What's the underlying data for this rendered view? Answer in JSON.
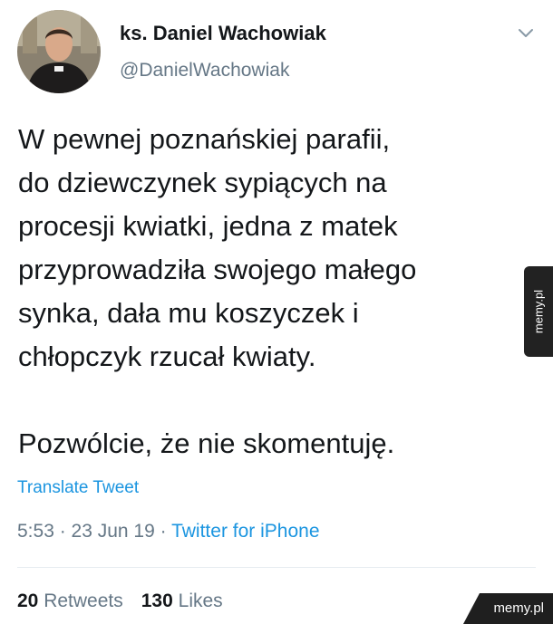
{
  "author": {
    "name": "ks. Daniel Wachowiak",
    "handle": "@DanielWachowiak"
  },
  "tweet": {
    "paragraphs": [
      "W pewnej poznańskiej parafii,\ndo dziewczynek sypiących na\nprocesji kwiatki, jedna z matek\nprzyprowadziła swojego małego\nsynka, dała mu koszyczek i\nchłopczyk rzucał kwiaty.",
      "Pozwólcie, że nie skomentuję."
    ],
    "translate_label": "Translate Tweet",
    "time": "5:53",
    "date": "23 Jun 19",
    "source": "Twitter for iPhone"
  },
  "stats": {
    "retweets_count": "20",
    "retweets_label": "Retweets",
    "likes_count": "130",
    "likes_label": "Likes"
  },
  "watermark": {
    "side": "memy.pl",
    "corner": "memy.pl"
  },
  "icons": {
    "chevron": "chevron-down-icon",
    "avatar": "avatar-photo"
  },
  "colors": {
    "link": "#1b95e0",
    "muted": "#657786",
    "text": "#14171a"
  }
}
